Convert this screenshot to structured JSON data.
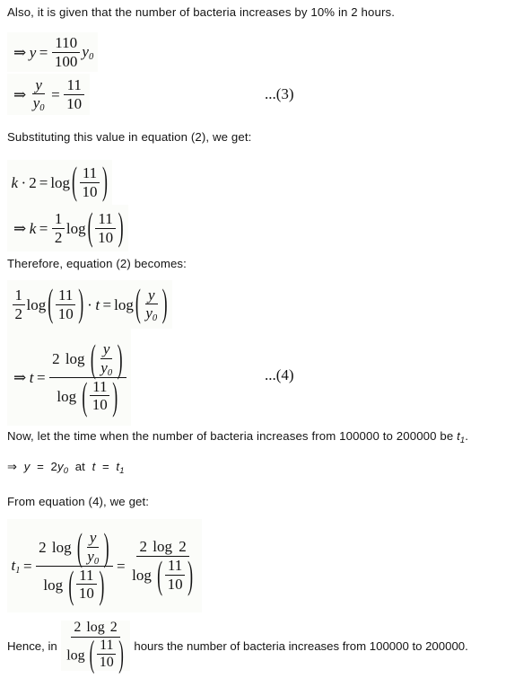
{
  "document": {
    "type": "math-solution-page",
    "topic": "Bacteria growth differential equation solution",
    "background_color": "#ffffff",
    "text_color": "#141414",
    "math_background_color": "#fbfcf9"
  },
  "paragraphs": {
    "intro": "Also, it is given that the number of bacteria increases by 10% in 2 hours.",
    "substituting": "Substituting this value in equation (2), we get:",
    "therefore": "Therefore, equation (2) becomes:",
    "now_let_prefix": "Now, let the time when the number of bacteria increases from 100000 to 200000 be ",
    "now_let_var": "t",
    "now_let_sub": "1",
    "now_let_suffix": ".",
    "from_equation": "From equation (4), we get:",
    "hence_prefix": "Hence, in",
    "hence_suffix": "hours the number of bacteria increases from 100000 to 200000."
  },
  "condition_line": {
    "arrow": "⇒",
    "y": "y",
    "equals": "=",
    "coefficient": "2",
    "y0_var": "y",
    "y0_sub": "0",
    "at": "at",
    "t": "t",
    "t_equals": "=",
    "t1_var": "t",
    "t1_sub": "1"
  },
  "equations": {
    "eq3a": {
      "arrow": "⇒",
      "lhs": "y",
      "equals": "=",
      "numerator": "110",
      "denominator": "100",
      "trailing_var": "y",
      "trailing_sub": "0"
    },
    "eq3b": {
      "arrow": "⇒",
      "left_num": "y",
      "left_den_var": "y",
      "left_den_sub": "0",
      "equals": "=",
      "right_num": "11",
      "right_den": "10",
      "label": "...(3)"
    },
    "eq_k": {
      "k": "k",
      "dot": "·",
      "two": "2",
      "equals": "=",
      "log": "log",
      "numerator": "11",
      "denominator": "10"
    },
    "eq_k_solved": {
      "arrow": "⇒",
      "k": "k",
      "equals": "=",
      "coef_num": "1",
      "coef_den": "2",
      "log": "log",
      "numerator": "11",
      "denominator": "10"
    },
    "eq2_becomes": {
      "coef_num": "1",
      "coef_den": "2",
      "log": "log",
      "left_num": "11",
      "left_den": "10",
      "dot": "·",
      "t": "t",
      "equals": "=",
      "log2": "log",
      "right_num": "y",
      "right_den_var": "y",
      "right_den_sub": "0"
    },
    "eq4": {
      "arrow": "⇒",
      "t": "t",
      "equals": "=",
      "num_coef": "2",
      "num_log": "log",
      "num_inner_num": "y",
      "num_inner_den_var": "y",
      "num_inner_den_sub": "0",
      "den_log": "log",
      "den_inner_num": "11",
      "den_inner_den": "10",
      "label": "...(4)"
    },
    "eq_t1": {
      "t_var": "t",
      "t_sub": "1",
      "equals": "=",
      "left_num_coef": "2",
      "left_num_log": "log",
      "left_num_inner_num": "y",
      "left_num_inner_den_var": "y",
      "left_num_inner_den_sub": "0",
      "left_den_log": "log",
      "left_den_inner_num": "11",
      "left_den_inner_den": "10",
      "equals2": "=",
      "right_num_coef": "2",
      "right_num_log": "log",
      "right_num_arg": "2",
      "right_den_log": "log",
      "right_den_inner_num": "11",
      "right_den_inner_den": "10"
    },
    "hence_frac": {
      "num_coef": "2",
      "num_log": "log",
      "num_arg": "2",
      "den_log": "log",
      "den_inner_num": "11",
      "den_inner_den": "10"
    }
  },
  "parens": {
    "left": "(",
    "right": ")"
  }
}
